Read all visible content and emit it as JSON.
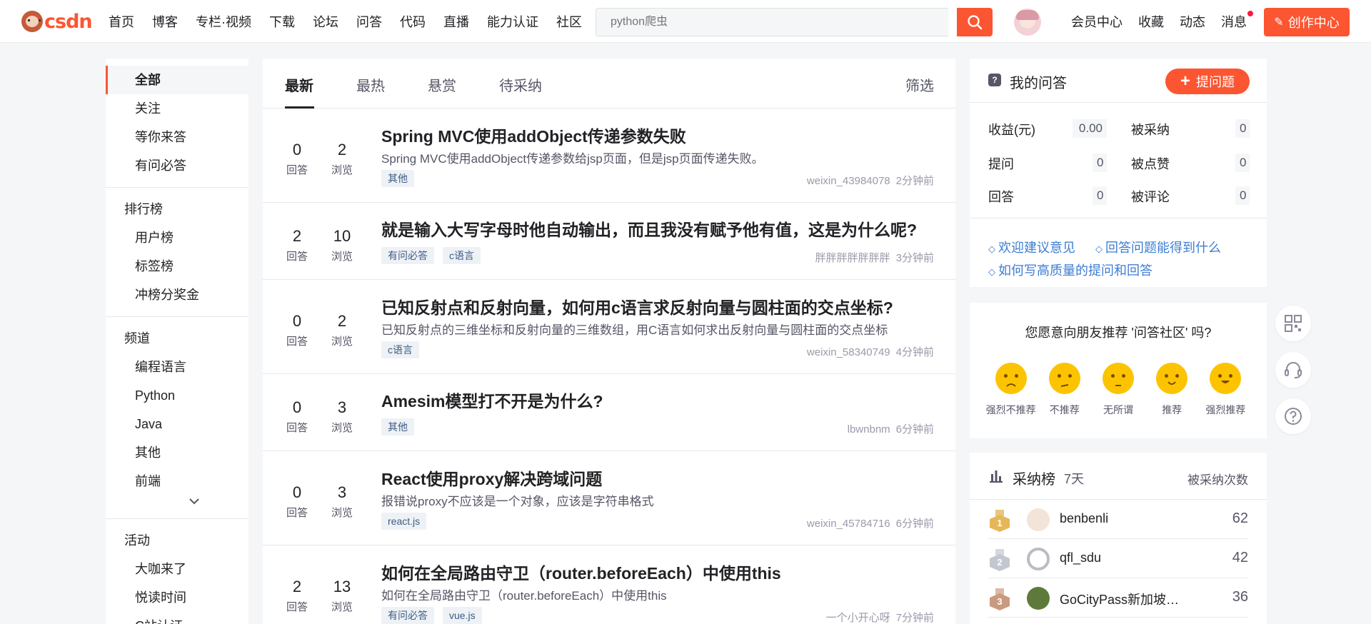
{
  "header": {
    "logo_text": "csdn",
    "nav": [
      "首页",
      "博客",
      "专栏·视频",
      "下载",
      "论坛",
      "问答",
      "代码",
      "直播",
      "能力认证",
      "社区"
    ],
    "search_placeholder": "python爬虫",
    "links": [
      "会员中心",
      "收藏",
      "动态",
      "消息"
    ],
    "create_label": "创作中心",
    "brand_color": "#fc5531"
  },
  "sidebar": {
    "top_items": [
      "全部",
      "关注",
      "等你来答",
      "有问必答"
    ],
    "ranking_title": "排行榜",
    "ranking_items": [
      "用户榜",
      "标签榜",
      "冲榜分奖金"
    ],
    "channel_title": "频道",
    "channel_items": [
      "编程语言",
      "Python",
      "Java",
      "其他",
      "前端"
    ],
    "activity_title": "活动",
    "activity_items": [
      "大咖来了",
      "悦读时间",
      "C站认证"
    ]
  },
  "tabs": {
    "items": [
      "最新",
      "最热",
      "悬赏",
      "待采纳"
    ],
    "filter": "筛选"
  },
  "questions": [
    {
      "answers": "0",
      "views": "2",
      "title": "Spring MVC使用addObject传递参数失败",
      "desc": "Spring MVC使用addObject传递参数给jsp页面，但是jsp页面传递失败。",
      "tags": [
        "其他"
      ],
      "author": "weixin_43984078",
      "time": "2分钟前"
    },
    {
      "answers": "2",
      "views": "10",
      "title": "就是输入大写字母时他自动输出，而且我没有赋予他有值，这是为什么呢?",
      "desc": "",
      "tags": [
        "有问必答",
        "c语言"
      ],
      "author": "胖胖胖胖胖胖胖",
      "time": "3分钟前"
    },
    {
      "answers": "0",
      "views": "2",
      "title": "已知反射点和反射向量，如何用c语言求反射向量与圆柱面的交点坐标?",
      "desc": "已知反射点的三维坐标和反射向量的三维数组，用C语言如何求出反射向量与圆柱面的交点坐标",
      "tags": [
        "c语言"
      ],
      "author": "weixin_58340749",
      "time": "4分钟前"
    },
    {
      "answers": "0",
      "views": "3",
      "title": "Amesim模型打不开是为什么?",
      "desc": "",
      "tags": [
        "其他"
      ],
      "author": "lbwnbnm",
      "time": "6分钟前"
    },
    {
      "answers": "0",
      "views": "3",
      "title": "React使用proxy解决跨域问题",
      "desc": "报错说proxy不应该是一个对象，应该是字符串格式",
      "tags": [
        "react.js"
      ],
      "author": "weixin_45784716",
      "time": "6分钟前"
    },
    {
      "answers": "2",
      "views": "13",
      "title": "如何在全局路由守卫（router.beforeEach）中使用this",
      "desc": "如何在全局路由守卫（router.beforeEach）中使用this",
      "tags": [
        "有问必答",
        "vue.js"
      ],
      "author": "一个小开心呀",
      "time": "7分钟前"
    }
  ],
  "stat_labels": {
    "answers": "回答",
    "views": "浏览"
  },
  "my_questions": {
    "title": "我的问答",
    "ask_label": "提问题",
    "stats": [
      {
        "label": "收益(元)",
        "value": "0.00"
      },
      {
        "label": "被采纳",
        "value": "0"
      },
      {
        "label": "提问",
        "value": "0"
      },
      {
        "label": "被点赞",
        "value": "0"
      },
      {
        "label": "回答",
        "value": "0"
      },
      {
        "label": "被评论",
        "value": "0"
      }
    ],
    "links": [
      "欢迎建议意见",
      "回答问题能得到什么",
      "如何写高质量的提问和回答"
    ]
  },
  "recommend": {
    "title": "您愿意向朋友推荐 '问答社区' 吗?",
    "options": [
      "强烈不推荐",
      "不推荐",
      "无所谓",
      "推荐",
      "强烈推荐"
    ]
  },
  "ranking": {
    "title": "采纳榜",
    "period": "7天",
    "column": "被采纳次数",
    "rows": [
      {
        "rank": "1",
        "name": "benbenli",
        "count": "62"
      },
      {
        "rank": "2",
        "name": "qfl_sdu",
        "count": "42"
      },
      {
        "rank": "3",
        "name": "GoCityPass新加坡曼谷…",
        "count": "36"
      }
    ]
  }
}
